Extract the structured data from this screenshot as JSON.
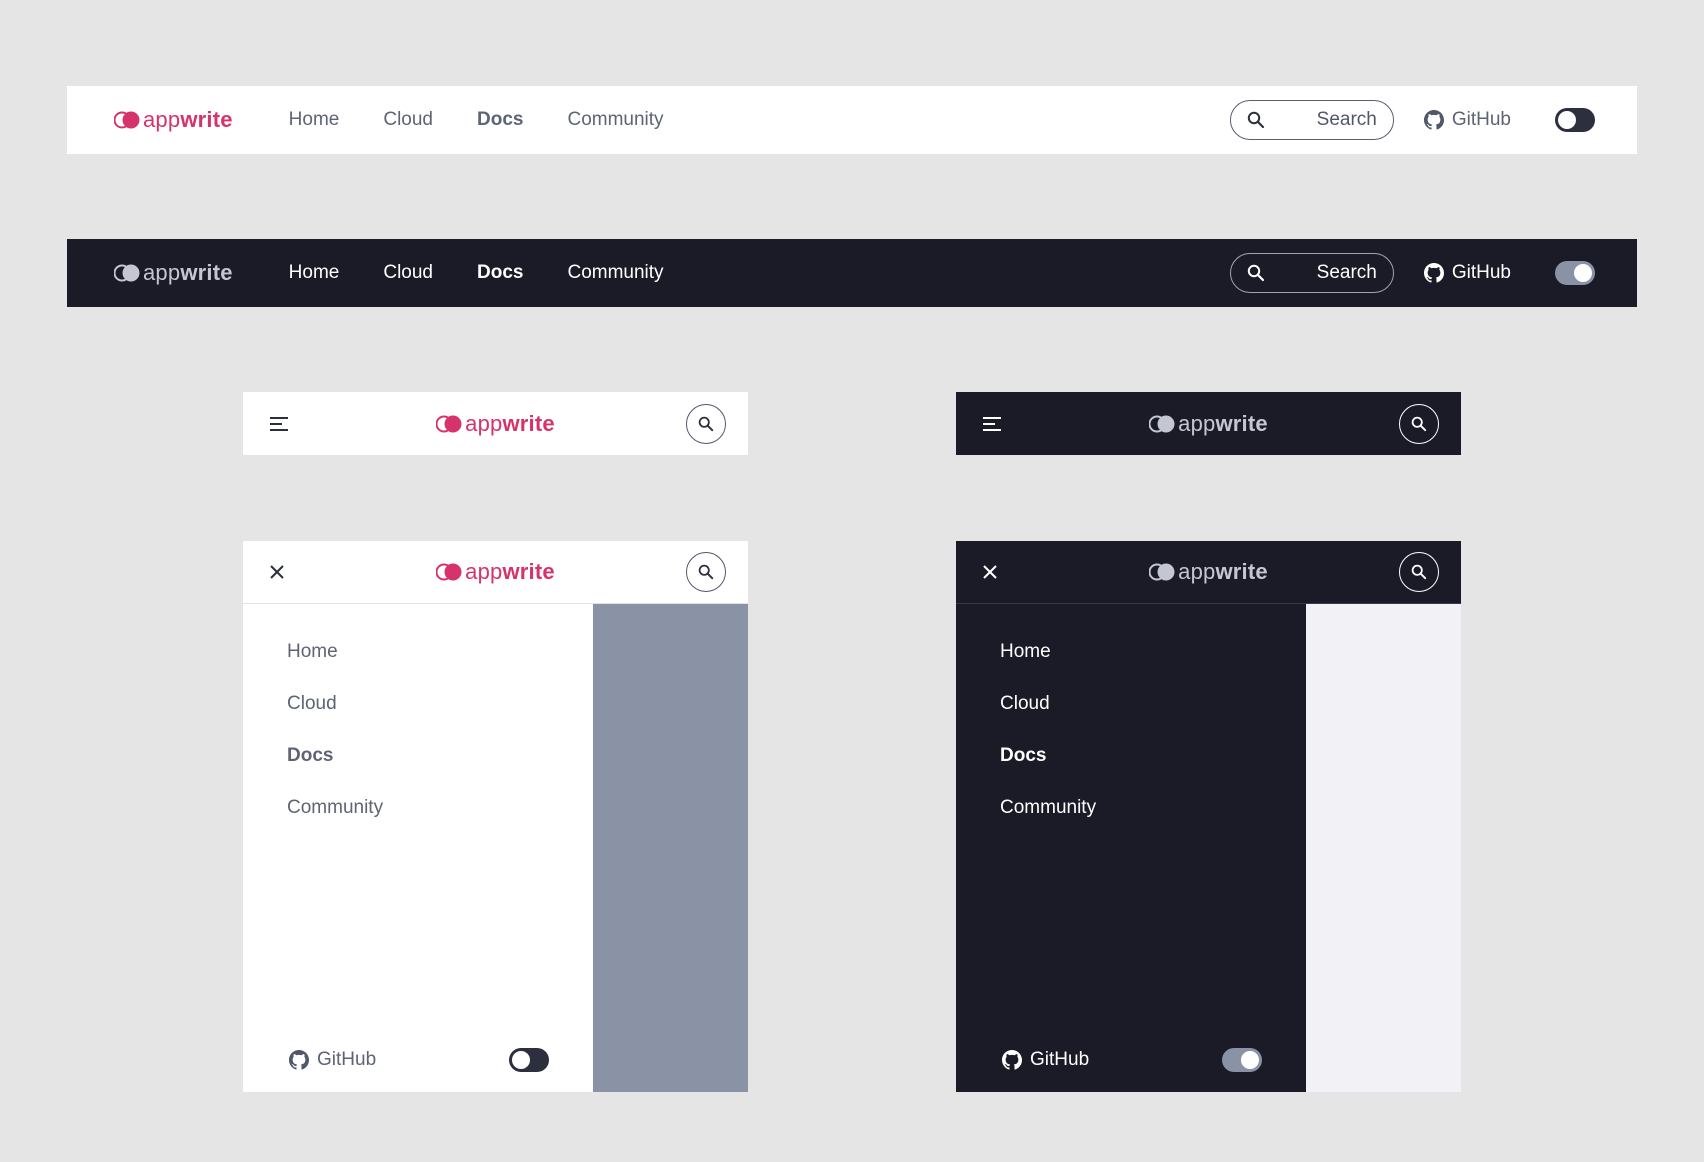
{
  "brand": {
    "logo_prefix": "app",
    "logo_suffix": "write",
    "accent": "#d6336c",
    "dark_bg": "#1b1b28"
  },
  "nav": [
    {
      "label": "Home"
    },
    {
      "label": "Cloud"
    },
    {
      "label": "Docs",
      "active": true
    },
    {
      "label": "Community"
    }
  ],
  "search": {
    "label": "Search",
    "icon": "search-icon"
  },
  "github": {
    "label": "GitHub",
    "icon": "github-icon"
  },
  "theme_toggle": {
    "light_variant_state": "off",
    "dark_variant_state": "on"
  },
  "mobile": {
    "menu_icon": "hamburger-icon",
    "close_icon": "close-icon",
    "search_icon": "search-icon"
  }
}
